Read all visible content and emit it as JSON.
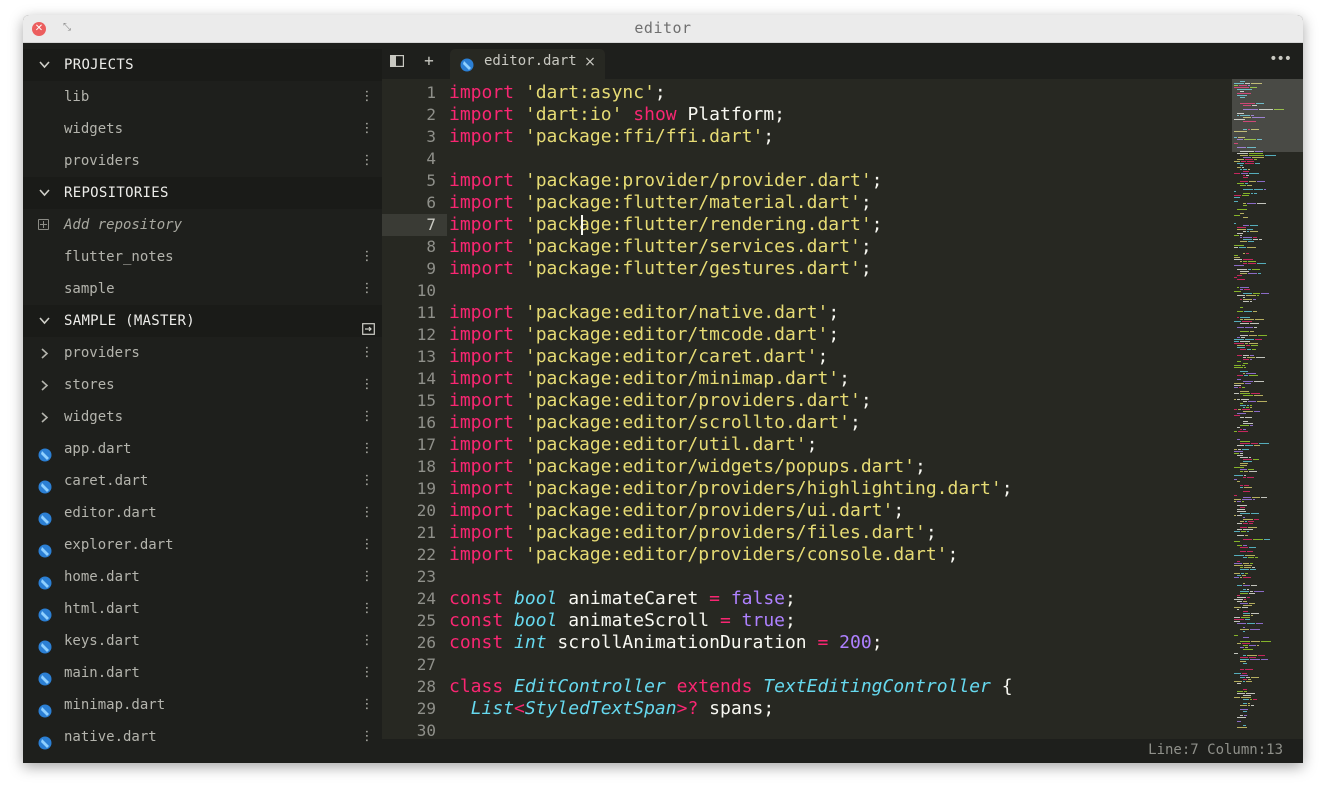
{
  "window": {
    "title": "editor"
  },
  "icons": {
    "close": "close-icon",
    "resize": "resize-icon",
    "dart": "dart-file-icon",
    "kebab": "kebab-menu-icon"
  },
  "colors": {
    "keyword": "#f92672",
    "string": "#e6db74",
    "type": "#66d9ef",
    "number": "#ae81ff",
    "text": "#f8f8f2",
    "background": "#272822",
    "sidebar": "#1e1f1c",
    "dart_icon": "#2b7fd4"
  },
  "sidebar": {
    "projects": {
      "title": "PROJECTS",
      "items": [
        "lib",
        "widgets",
        "providers"
      ]
    },
    "repositories": {
      "title": "REPOSITORIES",
      "add_label": "Add repository",
      "items": [
        "flutter_notes",
        "sample"
      ]
    },
    "sample": {
      "title": "SAMPLE (MASTER)",
      "folders": [
        "providers",
        "stores",
        "widgets"
      ],
      "files": [
        "app.dart",
        "caret.dart",
        "editor.dart",
        "explorer.dart",
        "home.dart",
        "html.dart",
        "keys.dart",
        "main.dart",
        "minimap.dart",
        "native.dart"
      ]
    }
  },
  "tabs": [
    {
      "label": "editor.dart",
      "close": "×"
    }
  ],
  "toolbar": {
    "sidebar_toggle": "☰",
    "new_tab": "+",
    "more": "•••"
  },
  "editor": {
    "current_line": 7,
    "lines": [
      [
        "import 'dart:async';"
      ],
      [
        "import 'dart:io' show Platform;"
      ],
      [
        "import 'package:ffi/ffi.dart';"
      ],
      [
        ""
      ],
      [
        "import 'package:provider/provider.dart';"
      ],
      [
        "import 'package:flutter/material.dart';"
      ],
      [
        "import 'package:flutter/rendering.dart';"
      ],
      [
        "import 'package:flutter/services.dart';"
      ],
      [
        "import 'package:flutter/gestures.dart';"
      ],
      [
        ""
      ],
      [
        "import 'package:editor/native.dart';"
      ],
      [
        "import 'package:editor/tmcode.dart';"
      ],
      [
        "import 'package:editor/caret.dart';"
      ],
      [
        "import 'package:editor/minimap.dart';"
      ],
      [
        "import 'package:editor/providers.dart';"
      ],
      [
        "import 'package:editor/scrollto.dart';"
      ],
      [
        "import 'package:editor/util.dart';"
      ],
      [
        "import 'package:editor/widgets/popups.dart';"
      ],
      [
        "import 'package:editor/providers/highlighting.dart';"
      ],
      [
        "import 'package:editor/providers/ui.dart';"
      ],
      [
        "import 'package:editor/providers/files.dart';"
      ],
      [
        "import 'package:editor/providers/console.dart';"
      ],
      [
        ""
      ],
      [
        "const bool animateCaret = false;"
      ],
      [
        "const bool animateScroll = true;"
      ],
      [
        "const int scrollAnimationDuration = 200;"
      ],
      [
        ""
      ],
      [
        "class EditController extends TextEditingController {"
      ],
      [
        "  List<StyledTextSpan>? spans;"
      ],
      [
        ""
      ]
    ]
  },
  "status": {
    "text": "Line:7 Column:13"
  }
}
